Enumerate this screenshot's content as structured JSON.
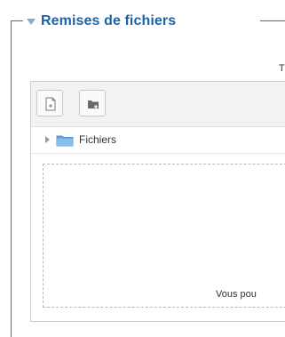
{
  "section": {
    "legend": "Remises de fichiers",
    "top_hint": "T"
  },
  "filemanager": {
    "toolbar": {
      "add_file_icon": "file-add-icon",
      "create_folder_icon": "folder-add-icon"
    },
    "path": {
      "label": "Fichiers",
      "expand_icon": "chevron-right-icon",
      "folder_icon": "folder-icon"
    },
    "dropzone_text": "Vous pou"
  },
  "colors": {
    "legend_text": "#1c64a8",
    "legend_arrow": "#8fa8c8",
    "folder": "#6aa7e0"
  }
}
